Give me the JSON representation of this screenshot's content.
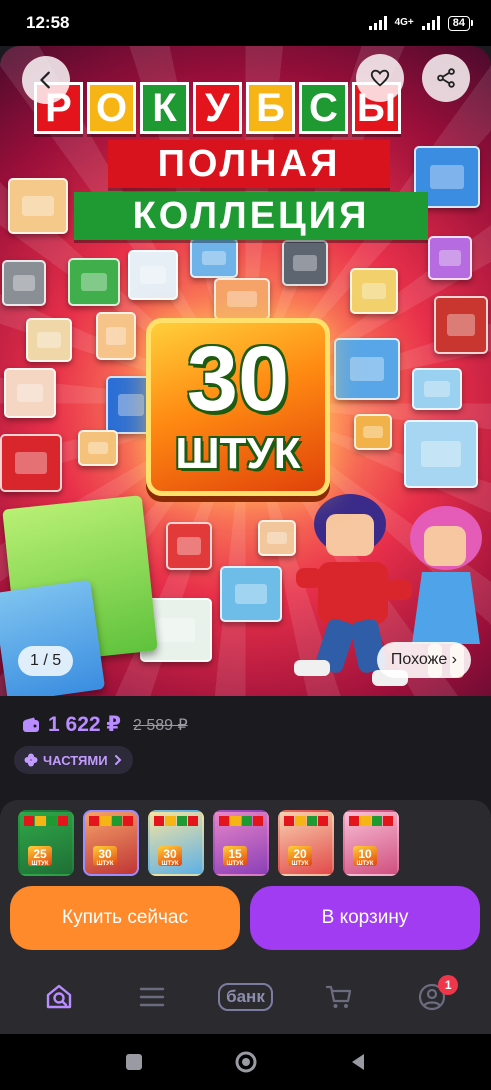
{
  "status_bar": {
    "time": "12:58",
    "network": "4G+",
    "battery": "84"
  },
  "hero": {
    "brand_letters": [
      "Р",
      "О",
      "К",
      "У",
      "Б",
      "С",
      "Ы"
    ],
    "banner_line1": "ПОЛНАЯ",
    "banner_line2": "КОЛЛЕЦИЯ",
    "badge_number": "30",
    "badge_word": "ШТУК",
    "pager": "1 / 5",
    "similar_label": "Похоже ›"
  },
  "product": {
    "price": "1 622 ₽",
    "old_price": "2 589 ₽",
    "installments_label": "ЧАСТЯМИ"
  },
  "thumbnails": [
    {
      "count": "25",
      "word": "ШТУК",
      "selected": false
    },
    {
      "count": "30",
      "word": "ШТУК",
      "selected": true
    },
    {
      "count": "30",
      "word": "ШТУК",
      "selected": false
    },
    {
      "count": "15",
      "word": "ШТУК",
      "selected": false
    },
    {
      "count": "20",
      "word": "ШТУК",
      "selected": false
    },
    {
      "count": "10",
      "word": "ШТУК",
      "selected": false
    }
  ],
  "actions": {
    "buy_now": "Купить сейчас",
    "add_to_cart": "В корзину"
  },
  "bottom_nav": {
    "bank_label": "банк",
    "profile_badge": "1"
  },
  "colors": {
    "accent": "#a13cf2",
    "buy": "#ff8a2b",
    "price": "#b98cff",
    "background": "#1b1b1f"
  }
}
